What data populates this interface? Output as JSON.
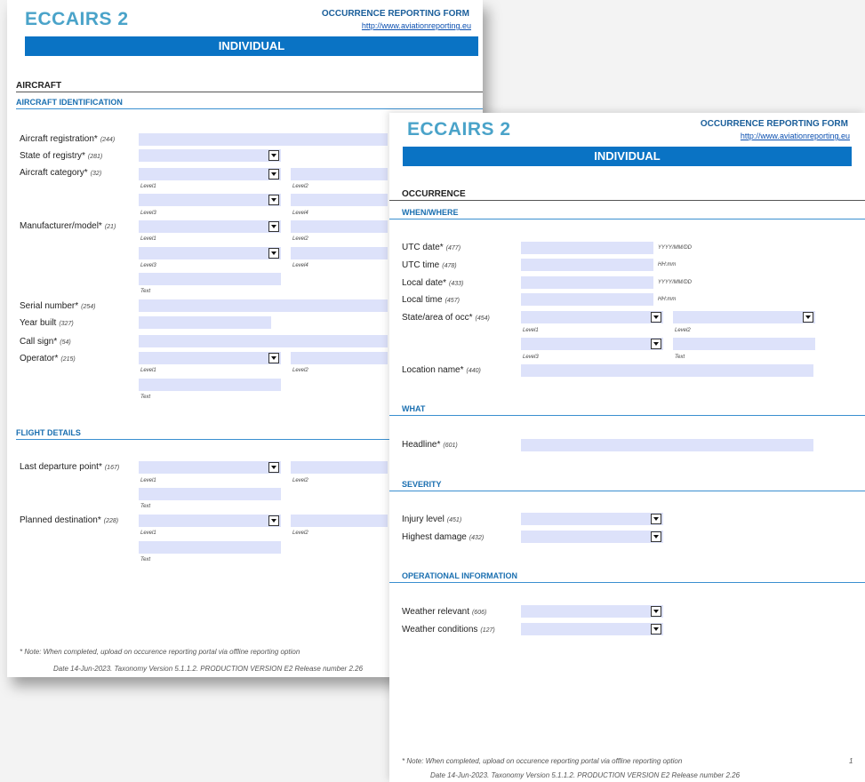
{
  "logo_text": "ECCAIRS 2",
  "form_title": "OCCURRENCE REPORTING FORM",
  "url": "http://www.aviationreporting.eu",
  "banner": "INDIVIDUAL",
  "note": "* Note: When completed, upload on occurence reporting portal via offline reporting option",
  "footer": "Date 14-Jun-2023. Taxonomy Version 5.1.1.2. PRODUCTION VERSION E2 Release number 2.26",
  "page_number": "1",
  "page1": {
    "section": "AIRCRAFT",
    "subsections": {
      "identification": "AIRCRAFT IDENTIFICATION",
      "flight": "FLIGHT DETAILS"
    },
    "fields": [
      {
        "label": "Aircraft registration*",
        "code": "(244)"
      },
      {
        "label": "State of registry*",
        "code": "(281)"
      },
      {
        "label": "Aircraft category*",
        "code": "(32)"
      },
      {
        "label": "Manufacturer/model*",
        "code": "(21)"
      },
      {
        "label": "Serial number*",
        "code": "(254)"
      },
      {
        "label": "Year built",
        "code": "(327)"
      },
      {
        "label": "Call sign*",
        "code": "(54)"
      },
      {
        "label": "Operator*",
        "code": "(215)"
      },
      {
        "label": "Last departure point*",
        "code": "(167)"
      },
      {
        "label": "Planned destination*",
        "code": "(228)"
      }
    ]
  },
  "page2": {
    "section": "OCCURRENCE",
    "subsections": {
      "when": "WHEN/WHERE",
      "what": "WHAT",
      "severity": "SEVERITY",
      "operational": "OPERATIONAL INFORMATION"
    },
    "fields": [
      {
        "label": "UTC date*",
        "code": "(477)",
        "hint": "YYYY/MM/DD"
      },
      {
        "label": "UTC time",
        "code": "(478)",
        "hint": "HH:mm"
      },
      {
        "label": "Local date*",
        "code": "(433)",
        "hint": "YYYY/MM/DD"
      },
      {
        "label": "Local time",
        "code": "(457)",
        "hint": "HH:mm"
      },
      {
        "label": "State/area of occ*",
        "code": "(454)"
      },
      {
        "label": "Location name*",
        "code": "(440)"
      },
      {
        "label": "Headline*",
        "code": "(601)"
      },
      {
        "label": "Injury level",
        "code": "(451)"
      },
      {
        "label": "Highest damage",
        "code": "(432)"
      },
      {
        "label": "Weather relevant",
        "code": "(606)"
      },
      {
        "label": "Weather conditions",
        "code": "(127)"
      }
    ]
  },
  "captions": {
    "level1": "Level1",
    "level2": "Level2",
    "level3": "Level3",
    "level4": "Level4",
    "text": "Text"
  }
}
